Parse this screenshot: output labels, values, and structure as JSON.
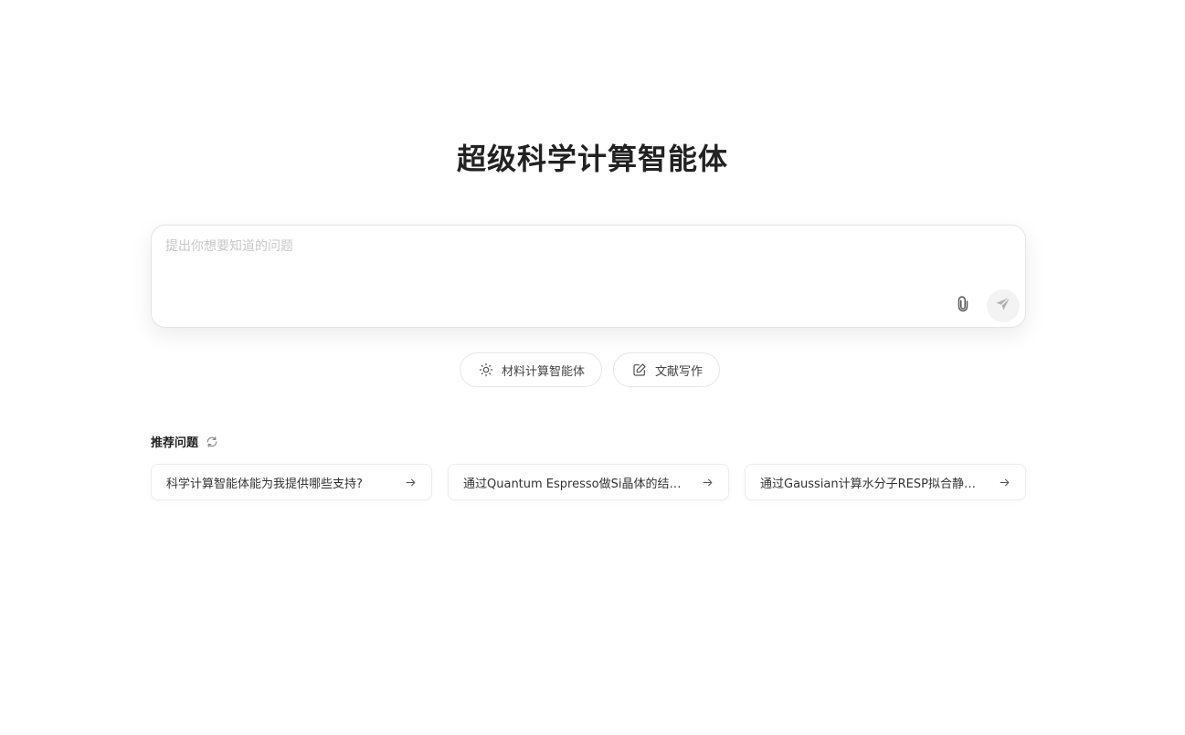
{
  "header": {
    "title": "超级科学计算智能体"
  },
  "composer": {
    "placeholder": "提出你想要知道的问题",
    "attach_icon": "paperclip-icon",
    "send_icon": "send-icon"
  },
  "modes": [
    {
      "label": "材料计算智能体",
      "icon": "sun-icon"
    },
    {
      "label": "文献写作",
      "icon": "edit-icon"
    }
  ],
  "recommended": {
    "title": "推荐问题",
    "refresh_icon": "refresh-icon",
    "items": [
      {
        "text": "科学计算智能体能为我提供哪些支持?"
      },
      {
        "text": "通过Quantum Espresso做Si晶体的结…"
      },
      {
        "text": "通过Gaussian计算水分子RESP拟合静…"
      }
    ]
  },
  "colors": {
    "background": "#ffffff",
    "title": "#222222",
    "border": "#e6e6e6",
    "placeholder": "#c8c8c8",
    "send_button_bg": "#f3f3f3"
  }
}
